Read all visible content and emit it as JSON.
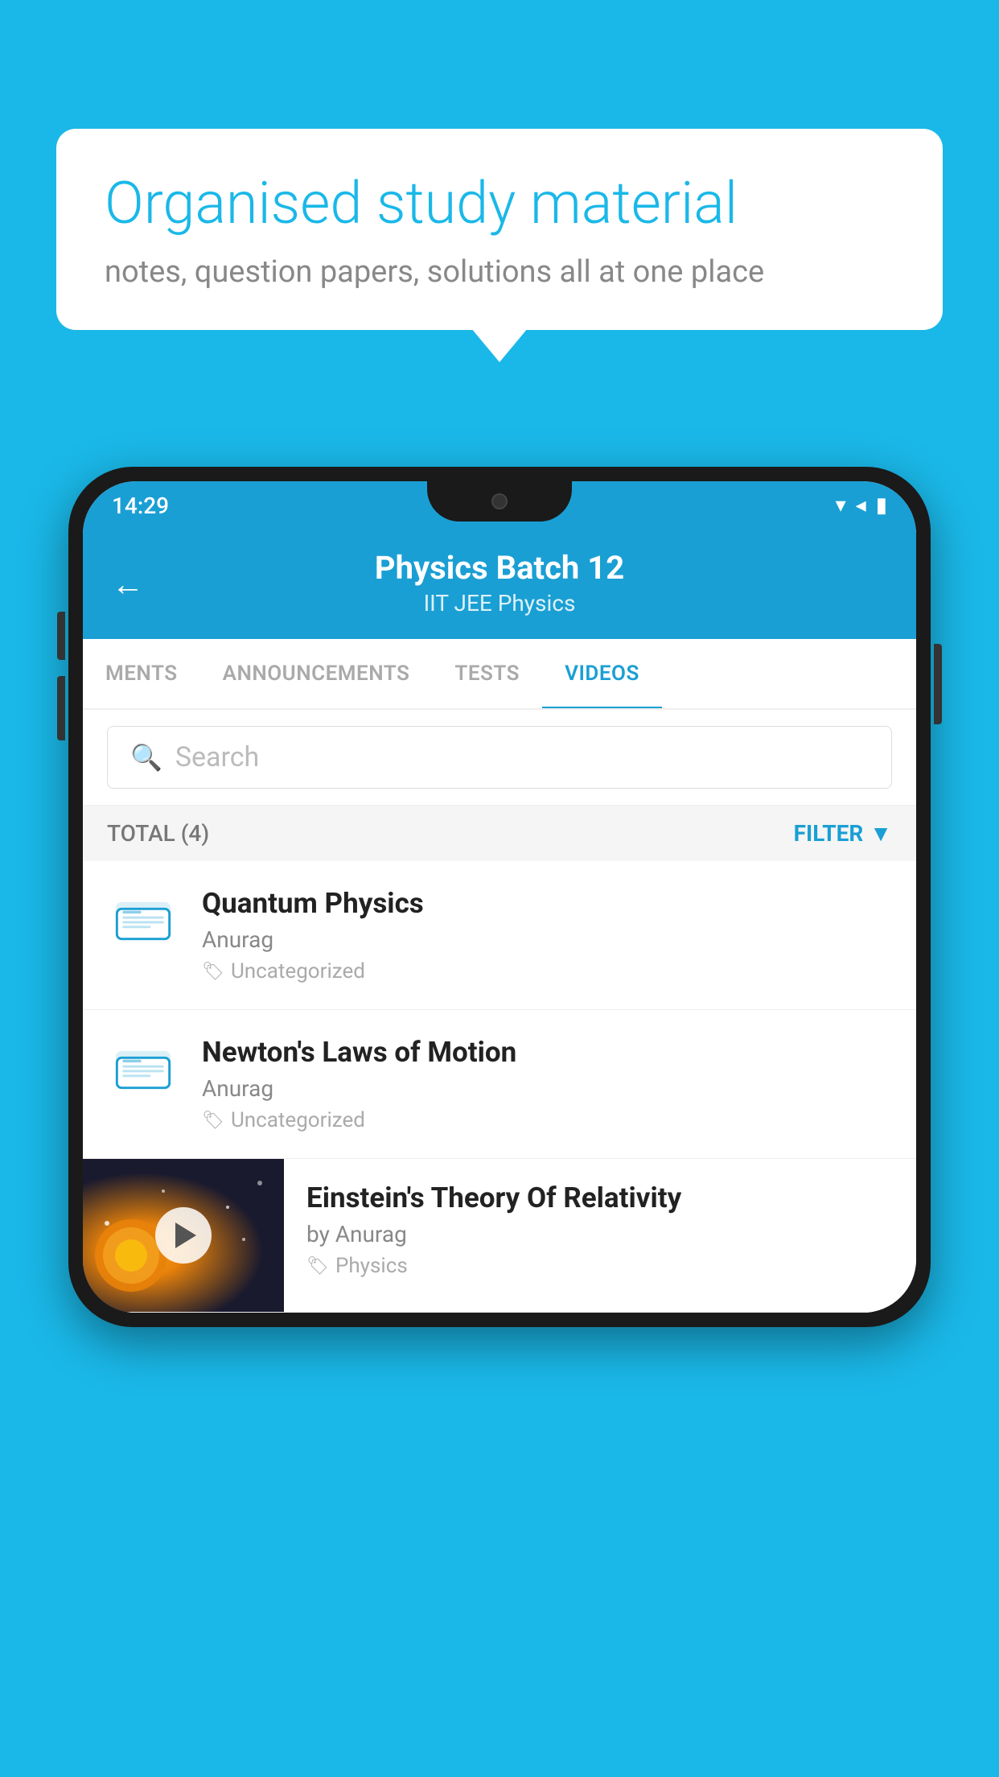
{
  "bubble": {
    "title": "Organised study material",
    "subtitle": "notes, question papers, solutions all at one place"
  },
  "status_bar": {
    "time": "14:29"
  },
  "header": {
    "title": "Physics Batch 12",
    "subtitle": "IIT JEE   Physics",
    "back_label": "←"
  },
  "tabs": [
    {
      "label": "MENTS",
      "active": false
    },
    {
      "label": "ANNOUNCEMENTS",
      "active": false
    },
    {
      "label": "TESTS",
      "active": false
    },
    {
      "label": "VIDEOS",
      "active": true
    }
  ],
  "search": {
    "placeholder": "Search"
  },
  "filter_bar": {
    "total_label": "TOTAL (4)",
    "filter_label": "FILTER"
  },
  "videos": [
    {
      "title": "Quantum Physics",
      "author": "Anurag",
      "tag": "Uncategorized",
      "has_thumb": false
    },
    {
      "title": "Newton's Laws of Motion",
      "author": "Anurag",
      "tag": "Uncategorized",
      "has_thumb": false
    },
    {
      "title": "Einstein's Theory Of Relativity",
      "author": "by Anurag",
      "tag": "Physics",
      "has_thumb": true
    }
  ]
}
